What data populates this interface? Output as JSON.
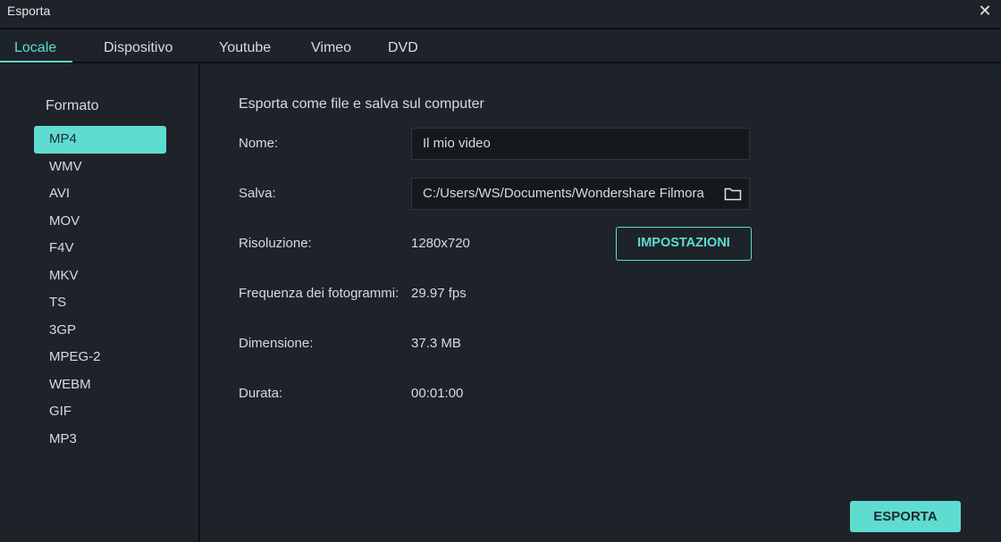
{
  "window": {
    "title": "Esporta",
    "close_icon": "close-icon"
  },
  "tabs": [
    {
      "label": "Locale",
      "active": true
    },
    {
      "label": "Dispositivo",
      "active": false
    },
    {
      "label": "Youtube",
      "active": false
    },
    {
      "label": "Vimeo",
      "active": false
    },
    {
      "label": "DVD",
      "active": false
    }
  ],
  "sidebar": {
    "label": "Formato",
    "selected": "MP4",
    "formats": [
      "MP4",
      "WMV",
      "AVI",
      "MOV",
      "F4V",
      "MKV",
      "TS",
      "3GP",
      "MPEG-2",
      "WEBM",
      "GIF",
      "MP3"
    ]
  },
  "main": {
    "heading": "Esporta come file e salva sul computer",
    "name": {
      "label": "Nome:",
      "value": "Il mio video"
    },
    "save": {
      "label": "Salva:",
      "value": "C:/Users/WS/Documents/Wondershare Filmora",
      "icon": "folder-icon"
    },
    "resolution": {
      "label": "Risoluzione:",
      "value": "1280x720"
    },
    "settings_button": "IMPOSTAZIONI",
    "framerate": {
      "label": "Frequenza dei fotogrammi:",
      "value": "29.97 fps"
    },
    "size": {
      "label": "Dimensione:",
      "value": "37.3 MB"
    },
    "duration": {
      "label": "Durata:",
      "value": "00:01:00"
    }
  },
  "export_button": "ESPORTA",
  "colors": {
    "accent": "#5fdcd0",
    "background": "#1e232a",
    "field": "#15191d"
  }
}
